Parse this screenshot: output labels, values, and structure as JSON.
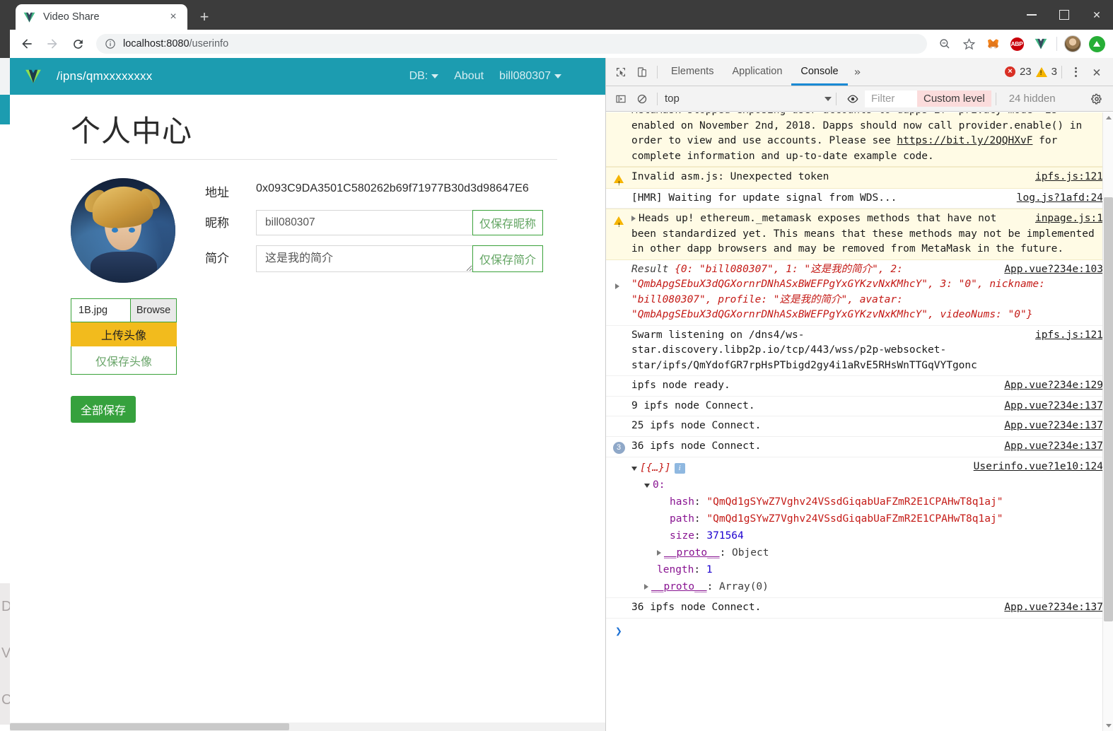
{
  "browser": {
    "tab": {
      "title": "Video Share",
      "favicon": "vue-logo-icon",
      "close": "×"
    },
    "new_tab_label": "+",
    "window_controls": {
      "minimize": "minimize-icon",
      "maximize": "maximize-icon",
      "close": "✕"
    },
    "nav": {
      "back": "back-arrow-icon",
      "forward": "forward-arrow-icon",
      "reload": "reload-icon"
    },
    "omnibox": {
      "info_icon": "info-circle-icon",
      "host": "localhost:8080",
      "path": "/userinfo"
    },
    "toolbar_icons": [
      {
        "name": "zoom-search-icon",
        "glyph": "⌕"
      },
      {
        "name": "bookmark-star-icon",
        "glyph": "☆"
      },
      {
        "name": "metamask-fox-icon",
        "glyph": "🦊"
      },
      {
        "name": "adblock-plus-icon",
        "label": "ABP"
      },
      {
        "name": "vue-devtools-icon",
        "glyph": "V"
      },
      {
        "name": "profile-avatar-icon",
        "glyph": ""
      },
      {
        "name": "update-chrome-icon",
        "glyph": "▲"
      }
    ]
  },
  "app": {
    "brand": "/ipns/qmxxxxxxxx",
    "nav": [
      {
        "label": "DB:",
        "caret": true
      },
      {
        "label": "About",
        "caret": false
      },
      {
        "label": "bill080307",
        "caret": true
      }
    ],
    "page_title": "个人中心",
    "fields": {
      "address_label": "地址",
      "address_value": "0x093C9DA3501C580262b69f71977B30d3d98647E6",
      "nickname_label": "昵称",
      "nickname_value": "bill080307",
      "nickname_save_label": "仅保存昵称",
      "profile_label": "简介",
      "profile_value": "这是我的简介",
      "profile_save_label": "仅保存简介"
    },
    "avatar": {
      "file_name": "1B.jpg",
      "browse_label": "Browse",
      "upload_label": "上传头像",
      "save_only_label": "仅保存头像"
    },
    "save_all_label": "全部保存",
    "colors": {
      "nav_teal": "#1c9cb0",
      "upload_yellow": "#f2bb1d",
      "save_green": "#36a13d",
      "border_green": "#3aa23a"
    }
  },
  "devtools": {
    "inspect_icon": "cursor-inspect-icon",
    "device_icon": "device-toolbar-icon",
    "tabs": [
      {
        "label": "Elements",
        "active": false
      },
      {
        "label": "Application",
        "active": false
      },
      {
        "label": "Console",
        "active": true
      }
    ],
    "more_tabs": "»",
    "error_count": "23",
    "warning_count": "3",
    "kebab_icon": "more-options-icon",
    "close_icon": "✕",
    "filterbar": {
      "sidebar_icon": "console-sidebar-icon",
      "clear_icon": "clear-console-icon",
      "context": "top",
      "eye_icon": "live-expression-icon",
      "filter_placeholder": "Filter",
      "level": "Custom level",
      "hidden": "24 hidden",
      "settings_icon": "gear-icon"
    },
    "messages": [
      {
        "type": "warn",
        "icon": "",
        "segments": [
          {
            "t": "MetaMask stopped exposing user accounts to dapps if \"privacy mode\" is enabled on November 2nd, 2018. Dapps should now call provider.enable() in order to view and use accounts. Please see "
          },
          {
            "t": "https://bit.ly/2QQHXvF",
            "link": true
          },
          {
            "t": " for complete information and up-to-date example code."
          }
        ],
        "source": ""
      },
      {
        "type": "warn",
        "icon": "warning-icon",
        "text": "Invalid asm.js: Unexpected token",
        "source": "ipfs.js:121"
      },
      {
        "type": "log",
        "text": "[HMR] Waiting for update signal from WDS...",
        "source": "log.js?1afd:24"
      },
      {
        "type": "warn",
        "icon": "warning-icon",
        "expandable": true,
        "text": "Heads up! ethereum._metamask exposes methods that have not been standardized yet. This means that these methods may not be implemented in other dapp browsers and may be removed from MetaMask in the future.",
        "source": "inpage.js:1"
      },
      {
        "type": "object",
        "expandable": true,
        "class_name": "Result ",
        "body": "{0: \"bill080307\", 1: \"这是我的简介\", 2: \"QmbApgSEbuX3dQGXornrDNhASxBWEFPgYxGYKzvNxKMhcY\", 3: \"0\", nickname: \"bill080307\", profile: \"这是我的简介\", avatar: \"QmbApgSEbuX3dQGXornrDNhASxBWEFPgYxGYKzvNxKMhcY\", videoNums: \"0\"}",
        "source": "App.vue?234e:103"
      },
      {
        "type": "log",
        "text": "Swarm listening on /dns4/ws-star.discovery.libp2p.io/tcp/443/wss/p2p-websocket-star/ipfs/QmYdofGR7rpHsPTbigd2gy4i1aRvE5RHsWnTTGqVYTgonc",
        "source": "ipfs.js:121"
      },
      {
        "type": "log",
        "text": "ipfs node ready.",
        "source": "App.vue?234e:129"
      },
      {
        "type": "log",
        "text": "9 ipfs node Connect.",
        "source": "App.vue?234e:137"
      },
      {
        "type": "log",
        "text": "25 ipfs node Connect.",
        "source": "App.vue?234e:137"
      },
      {
        "type": "log",
        "badge": "3",
        "text": "36 ipfs node Connect.",
        "source": "App.vue?234e:137"
      }
    ],
    "object_tree": {
      "source": "Userinfo.vue?1e10:124",
      "root_label": "[{…}]",
      "index_label": "0:",
      "rows": [
        {
          "key": "hash",
          "value": "\"QmQd1gSYwZ7Vghv24VSsdGiqabUaFZmR2E1CPAHwT8q1aj\"",
          "kind": "string"
        },
        {
          "key": "path",
          "value": "\"QmQd1gSYwZ7Vghv24VSsdGiqabUaFZmR2E1CPAHwT8q1aj\"",
          "kind": "string"
        },
        {
          "key": "size",
          "value": "371564",
          "kind": "number"
        },
        {
          "key": "__proto__",
          "value": "Object",
          "kind": "proto"
        }
      ],
      "length_key": "length",
      "length_value": "1",
      "proto_key": "__proto__",
      "proto_value": "Array(0)"
    },
    "last_message": {
      "text": "36 ipfs node Connect.",
      "source": "App.vue?234e:137"
    },
    "prompt": "❯"
  }
}
